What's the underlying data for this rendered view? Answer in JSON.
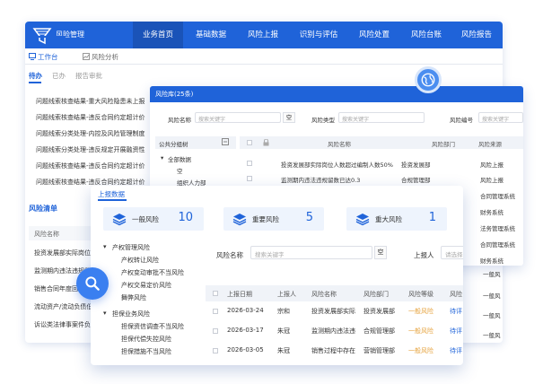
{
  "back": {
    "app_title": "风险管理",
    "nav": [
      "业务首页",
      "基础数据",
      "风险上报",
      "识别与评估",
      "风险处置",
      "风险台账",
      "风险报告"
    ],
    "tabs": [
      "工作台",
      "风险分析"
    ],
    "subtabs": [
      "待办",
      "已办",
      "报告审批"
    ],
    "notices": [
      "问题线索核查结果-重大风险隐患未上报",
      "问题线索核查结果-违反合同约定超计价",
      "问题线索分类处理-内控及风险管理制度",
      "问题线索分类处理-违反规定开展融资性",
      "问题线索核查结果-违反合同约定超计价",
      "问题线索核查结果-违反合同约定超计价"
    ],
    "risk_list": {
      "title": "风险清单",
      "header": "风险名称",
      "rows": [
        "投资发展部实际岗位人",
        "监测期内违法违规留",
        "销售合同年度回款",
        "流动资产/流动负债低",
        "诉讼类法律事案件负"
      ]
    }
  },
  "mid": {
    "title": "风险库(25条)",
    "filters": {
      "name_label": "风险名称",
      "name_placeholder": "搜索关键字",
      "type_label": "风险类型",
      "type_placeholder": "搜索关键字",
      "code_label": "风险编号",
      "code_placeholder": "搜索关键字",
      "btn": "空"
    },
    "tree": {
      "head": "公共分组树",
      "nodes": [
        "全部数据",
        "空",
        "组织人力部"
      ]
    },
    "columns": [
      "风险名称",
      "风险部门",
      "风险来源"
    ],
    "rows": [
      {
        "name": "投资发展部实际岗位人数超过编制人数50%",
        "dept": "投资发展部",
        "source": "风险上报"
      },
      {
        "name": "监测期内违法违规留数已达0.3",
        "dept": "合规管理部",
        "source": "风险上报"
      },
      {
        "name": "",
        "dept": "",
        "source": "合同管理系统"
      },
      {
        "name": "",
        "dept": "",
        "source": "财务系统"
      },
      {
        "name": "",
        "dept": "",
        "source": "法务管理系统"
      },
      {
        "name": "",
        "dept": "",
        "source": "合同管理系统"
      },
      {
        "name": "",
        "dept": "",
        "source": "财务系统"
      }
    ]
  },
  "front": {
    "title": "上报数据",
    "kpis": [
      {
        "label": "一般风险",
        "value": "10"
      },
      {
        "label": "重要风险",
        "value": "5"
      },
      {
        "label": "重大风险",
        "value": "1"
      }
    ],
    "tree": [
      {
        "label": "产权管理风险",
        "group": true
      },
      {
        "label": "产权转让风险",
        "group": false
      },
      {
        "label": "产权变动审批不当风险",
        "group": false
      },
      {
        "label": "产权交易定价风险",
        "group": false
      },
      {
        "label": "舞弊风险",
        "group": false
      },
      {
        "label": "担保业务风险",
        "group": true
      },
      {
        "label": "担保资信调查不当风险",
        "group": false
      },
      {
        "label": "担保代偿失控风险",
        "group": false
      },
      {
        "label": "担保措施不当风险",
        "group": false
      }
    ],
    "filter": {
      "name_label": "风险名称",
      "name_placeholder": "搜索关键字",
      "btn": "空",
      "reporter_label": "上报人",
      "reporter_placeholder": "请选择"
    },
    "columns": [
      "上报日期",
      "上报人",
      "风险名称",
      "风险部门",
      "风险等级",
      "风险"
    ],
    "rows": [
      {
        "date": "2026-03-24",
        "reporter": "宗和",
        "name": "投资发展部实际",
        "dept": "投资发展部",
        "level": "一般风险",
        "status": "待评"
      },
      {
        "date": "2026-03-17",
        "reporter": "朱冠",
        "name": "监测期内违法违",
        "dept": "合规管理部",
        "level": "一般风险",
        "status": "待评"
      },
      {
        "date": "2026-03-05",
        "reporter": "朱冠",
        "name": "销售过程中存在",
        "dept": "营销管理部",
        "level": "一般风险",
        "status": "待评"
      }
    ],
    "right_col_extra": [
      "一般风",
      "一般风",
      "一般风",
      "一般风"
    ]
  },
  "colors": {
    "primary": "#1f63d9",
    "warning": "#e6a23c"
  },
  "icons": [
    "globe-icon",
    "search-icon",
    "stack-icon",
    "checkbox-icon",
    "tree-toggle-icon"
  ]
}
